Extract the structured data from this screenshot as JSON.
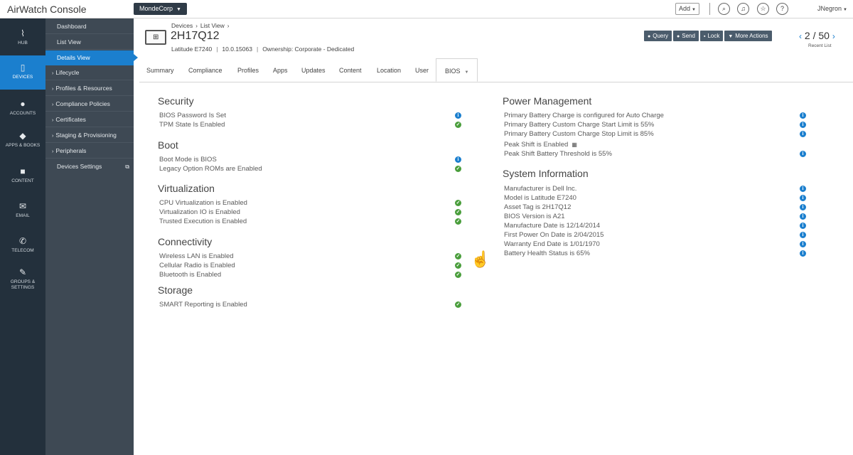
{
  "topbar": {
    "app_title": "AirWatch Console",
    "org": "MondeCorp",
    "add_label": "Add",
    "user": "JNegron"
  },
  "leftnav": {
    "items": [
      {
        "label": "HUB",
        "icon": "pulse-icon"
      },
      {
        "label": "DEVICES",
        "icon": "phone-icon"
      },
      {
        "label": "ACCOUNTS",
        "icon": "users-icon"
      },
      {
        "label": "APPS & BOOKS",
        "icon": "layers-icon"
      },
      {
        "label": "CONTENT",
        "icon": "document-icon"
      },
      {
        "label": "EMAIL",
        "icon": "envelope-icon"
      },
      {
        "label": "TELECOM",
        "icon": "phone-handset-icon"
      },
      {
        "label": "GROUPS & SETTINGS",
        "icon": "wrench-icon"
      }
    ]
  },
  "submenu": {
    "items": [
      {
        "label": "Dashboard"
      },
      {
        "label": "List View"
      },
      {
        "label": "Details View"
      },
      {
        "label": "Lifecycle"
      },
      {
        "label": "Profiles & Resources"
      },
      {
        "label": "Compliance Policies"
      },
      {
        "label": "Certificates"
      },
      {
        "label": "Staging & Provisioning"
      },
      {
        "label": "Peripherals"
      },
      {
        "label": "Devices Settings"
      }
    ]
  },
  "header": {
    "breadcrumb": [
      "Devices",
      "List View"
    ],
    "device_name": "2H17Q12",
    "model": "Latitude E7240",
    "os_version": "10.0.15063",
    "ownership": "Ownership: Corporate - Dedicated",
    "actions": [
      "Query",
      "Send",
      "Lock",
      "More Actions"
    ],
    "pager_current": "2",
    "pager_total": "50",
    "pager_sub": "Recent List"
  },
  "tabs": [
    "Summary",
    "Compliance",
    "Profiles",
    "Apps",
    "Updates",
    "Content",
    "Location",
    "User",
    "BIOS"
  ],
  "left_sections": [
    {
      "title": "Security",
      "rows": [
        {
          "text": "BIOS Password Is Set",
          "status": "info"
        },
        {
          "text": "TPM State Is Enabled",
          "status": "ok"
        }
      ]
    },
    {
      "title": "Boot",
      "rows": [
        {
          "text": "Boot Mode is BIOS",
          "status": "info"
        },
        {
          "text": "Legacy Option ROMs are Enabled",
          "status": "ok"
        }
      ]
    },
    {
      "title": "Virtualization",
      "rows": [
        {
          "text": "CPU Virtualization is Enabled",
          "status": "ok"
        },
        {
          "text": "Virtualization IO is Enabled",
          "status": "ok"
        },
        {
          "text": "Trusted Execution is Enabled",
          "status": "ok"
        }
      ]
    },
    {
      "title": "Connectivity",
      "rows": [
        {
          "text": "Wireless LAN is Enabled",
          "status": "ok"
        },
        {
          "text": "Cellular Radio is Enabled",
          "status": "ok"
        },
        {
          "text": "Bluetooth is Enabled",
          "status": "ok"
        }
      ]
    },
    {
      "title": "Storage",
      "rows": [
        {
          "text": "SMART Reporting is Enabled",
          "status": "ok"
        }
      ]
    }
  ],
  "right_sections": [
    {
      "title": "Power Management",
      "rows": [
        {
          "text": "Primary Battery Charge is configured for Auto Charge",
          "status": "info"
        },
        {
          "text": "Primary Battery Custom Charge Start Limit is 55%",
          "status": "info"
        },
        {
          "text": "Primary Battery Custom Charge Stop Limit is 85%",
          "status": "info"
        },
        {
          "text": "Peak Shift is Enabled",
          "status": "none"
        },
        {
          "text": "Peak Shift Battery Threshold is 55%",
          "status": "info"
        }
      ]
    },
    {
      "title": "System Information",
      "rows": [
        {
          "text": "Manufacturer is Dell Inc.",
          "status": "info"
        },
        {
          "text": "Model is Latitude E7240",
          "status": "info"
        },
        {
          "text": "Asset Tag is 2H17Q12",
          "status": "info"
        },
        {
          "text": "BIOS Version is A21",
          "status": "info"
        },
        {
          "text": "Manufacture Date is 12/14/2014",
          "status": "info"
        },
        {
          "text": "First Power On Date is 2/04/2015",
          "status": "info"
        },
        {
          "text": "Warranty End Date is 1/01/1970",
          "status": "info"
        },
        {
          "text": "Battery Health Status is 65%",
          "status": "info"
        }
      ]
    }
  ],
  "colors": {
    "accent": "#1b7fce",
    "ok": "#4a9e3c",
    "nav_bg": "#23303c",
    "submenu_bg": "#3e4954"
  }
}
